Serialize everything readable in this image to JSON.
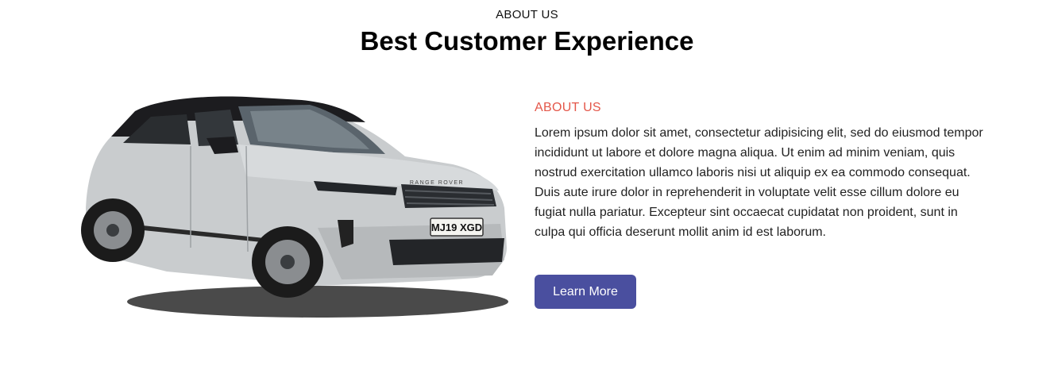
{
  "header": {
    "eyebrow": "ABOUT US",
    "title": "Best Customer Experience"
  },
  "about": {
    "eyebrow": "ABOUT US",
    "body": "Lorem ipsum dolor sit amet, consectetur adipisicing elit, sed do eiusmod tempor incididunt ut labore et dolore magna aliqua. Ut enim ad minim veniam, quis nostrud exercitation ullamco laboris nisi ut aliquip ex ea commodo consequat. Duis aute irure dolor in reprehenderit in voluptate velit esse cillum dolore eu fugiat nulla pariatur. Excepteur sint occaecat cupidatat non proident, sunt in culpa qui officia deserunt mollit anim id est laborum.",
    "button_label": "Learn More"
  },
  "car": {
    "grille_badge": "RANGE ROVER",
    "plate": "MJ19 XGD"
  },
  "colors": {
    "accent": "#e4574a",
    "button": "#4a4f9f",
    "car_body": "#c9ccce",
    "car_roof": "#1c1c1f"
  }
}
